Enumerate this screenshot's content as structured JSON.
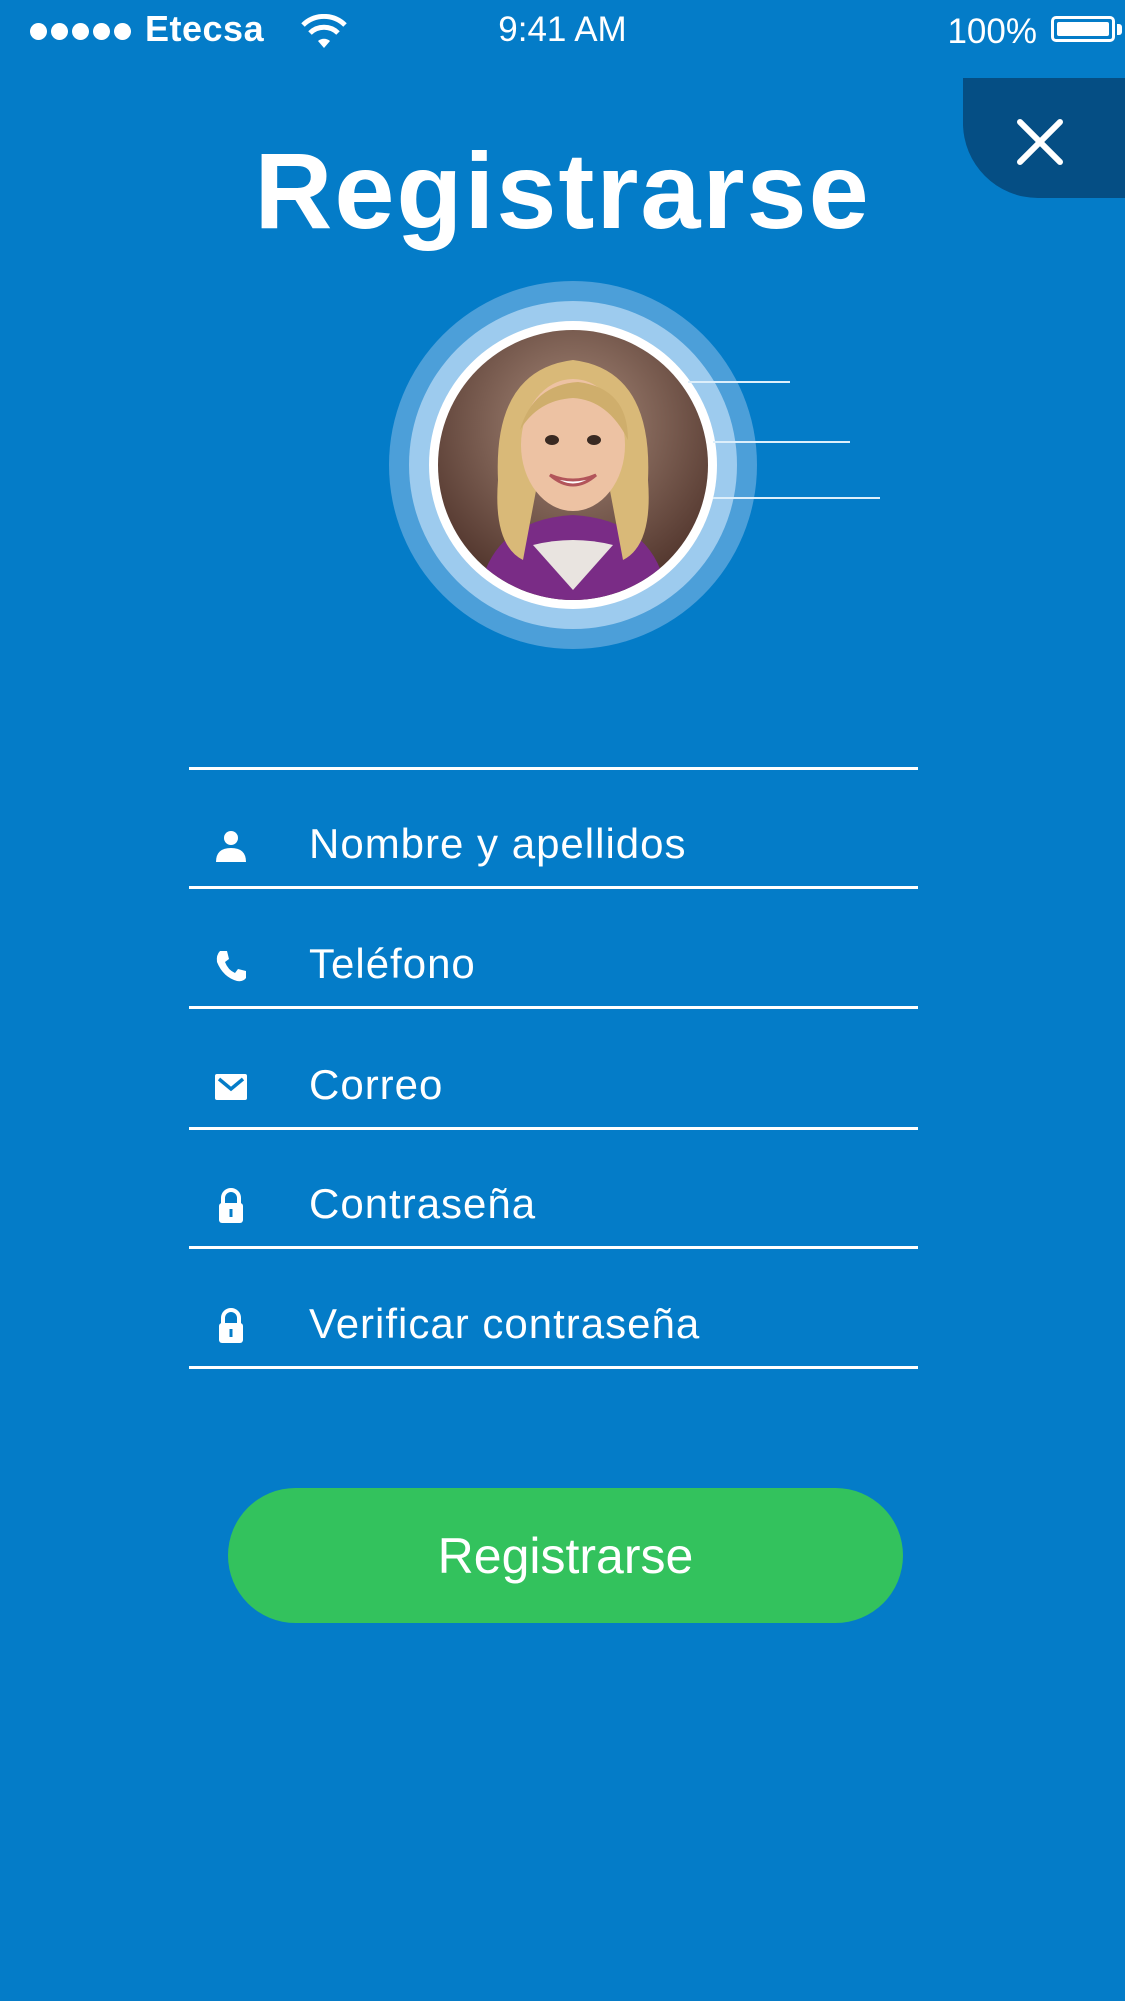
{
  "status_bar": {
    "carrier": "Etecsa",
    "time": "9:41 AM",
    "battery": "100%",
    "signal_bars": 5
  },
  "header": {
    "title": "Registrarse",
    "close_icon": "close-icon"
  },
  "avatar": {
    "alt": "profile-photo"
  },
  "form": {
    "fields": [
      {
        "icon": "user-icon",
        "placeholder": "Nombre y apellidos"
      },
      {
        "icon": "phone-icon",
        "placeholder": "Teléfono"
      },
      {
        "icon": "mail-icon",
        "placeholder": "Correo"
      },
      {
        "icon": "lock-icon",
        "placeholder": "Contraseña"
      },
      {
        "icon": "lock-icon",
        "placeholder": "Verificar contraseña"
      }
    ],
    "submit_label": "Registrarse"
  },
  "colors": {
    "background": "#047CC8",
    "close_tab": "#054E84",
    "submit": "#33C25D",
    "text": "#FFFFFF"
  }
}
